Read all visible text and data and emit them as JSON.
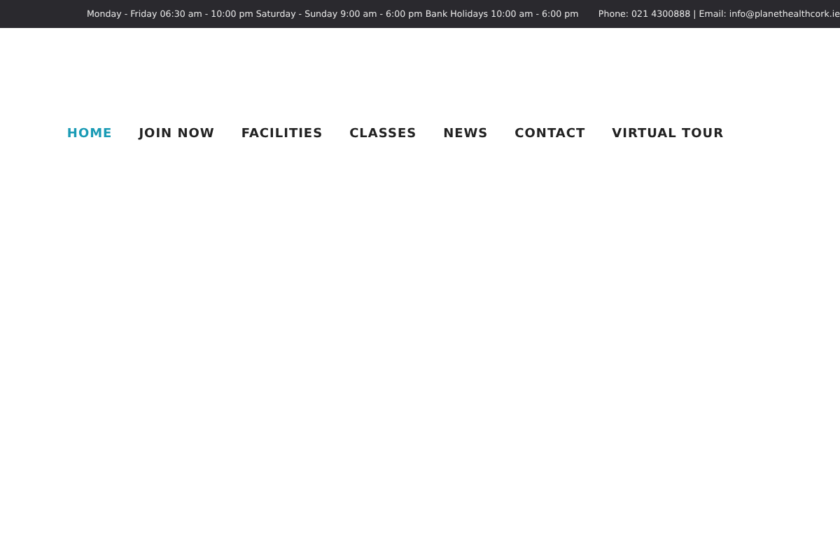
{
  "top_bar": {
    "hours": "Monday - Friday 06:30 am - 10:00 pm Saturday - Sunday 9:00 am - 6:00 pm Bank Holidays 10:00 am - 6:00 pm",
    "contact": "Phone: 021 4300888 | Email: info@planethealthcork.ie"
  },
  "nav": [
    {
      "label": "HOME",
      "selected": true
    },
    {
      "label": "JOIN NOW",
      "selected": false
    },
    {
      "label": "FACILITIES",
      "selected": false
    },
    {
      "label": "CLASSES",
      "selected": false
    },
    {
      "label": "NEWS",
      "selected": false
    },
    {
      "label": "CONTACT",
      "selected": false
    },
    {
      "label": "VIRTUAL TOUR",
      "selected": false
    }
  ]
}
